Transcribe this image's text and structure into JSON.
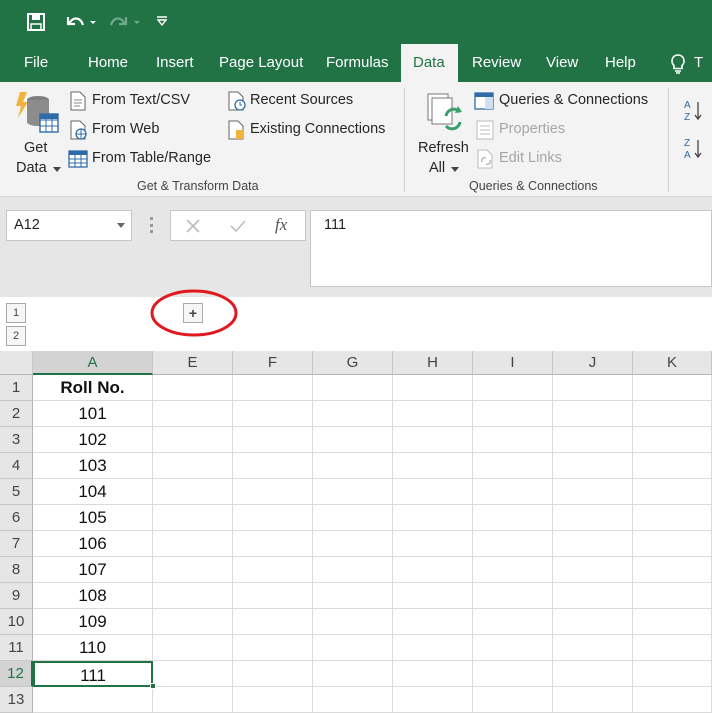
{
  "qat": {
    "save_icon": "save-icon",
    "undo_icon": "undo-icon",
    "redo_icon": "redo-icon",
    "customize_icon": "customize-qat-icon"
  },
  "tabs": [
    "File",
    "Home",
    "Insert",
    "Page Layout",
    "Formulas",
    "Data",
    "Review",
    "View",
    "Help"
  ],
  "active_tab": "Data",
  "tell_me_partial": "T",
  "ribbon": {
    "get_data_line1": "Get",
    "get_data_line2": "Data",
    "from_text_csv": "From Text/CSV",
    "from_web": "From Web",
    "from_table_range": "From Table/Range",
    "recent_sources": "Recent Sources",
    "existing_connections": "Existing Connections",
    "group1_label": "Get & Transform Data",
    "refresh_line1": "Refresh",
    "refresh_line2": "All",
    "queries_connections": "Queries & Connections",
    "properties": "Properties",
    "edit_links": "Edit Links",
    "group2_label": "Queries & Connections"
  },
  "formula_bar": {
    "name_box": "A12",
    "fx": "fx",
    "value": "111"
  },
  "outline": {
    "level1": "1",
    "level2": "2",
    "expand": "+"
  },
  "columns": [
    "A",
    "E",
    "F",
    "G",
    "H",
    "I",
    "J",
    "K"
  ],
  "rows": [
    "1",
    "2",
    "3",
    "4",
    "5",
    "6",
    "7",
    "8",
    "9",
    "10",
    "11",
    "12",
    "13"
  ],
  "column_a": [
    "Roll No.",
    "101",
    "102",
    "103",
    "104",
    "105",
    "106",
    "107",
    "108",
    "109",
    "110",
    "111",
    ""
  ],
  "selected_cell": "A12",
  "colors": {
    "brand": "#217346",
    "annotation": "#e0191f"
  }
}
